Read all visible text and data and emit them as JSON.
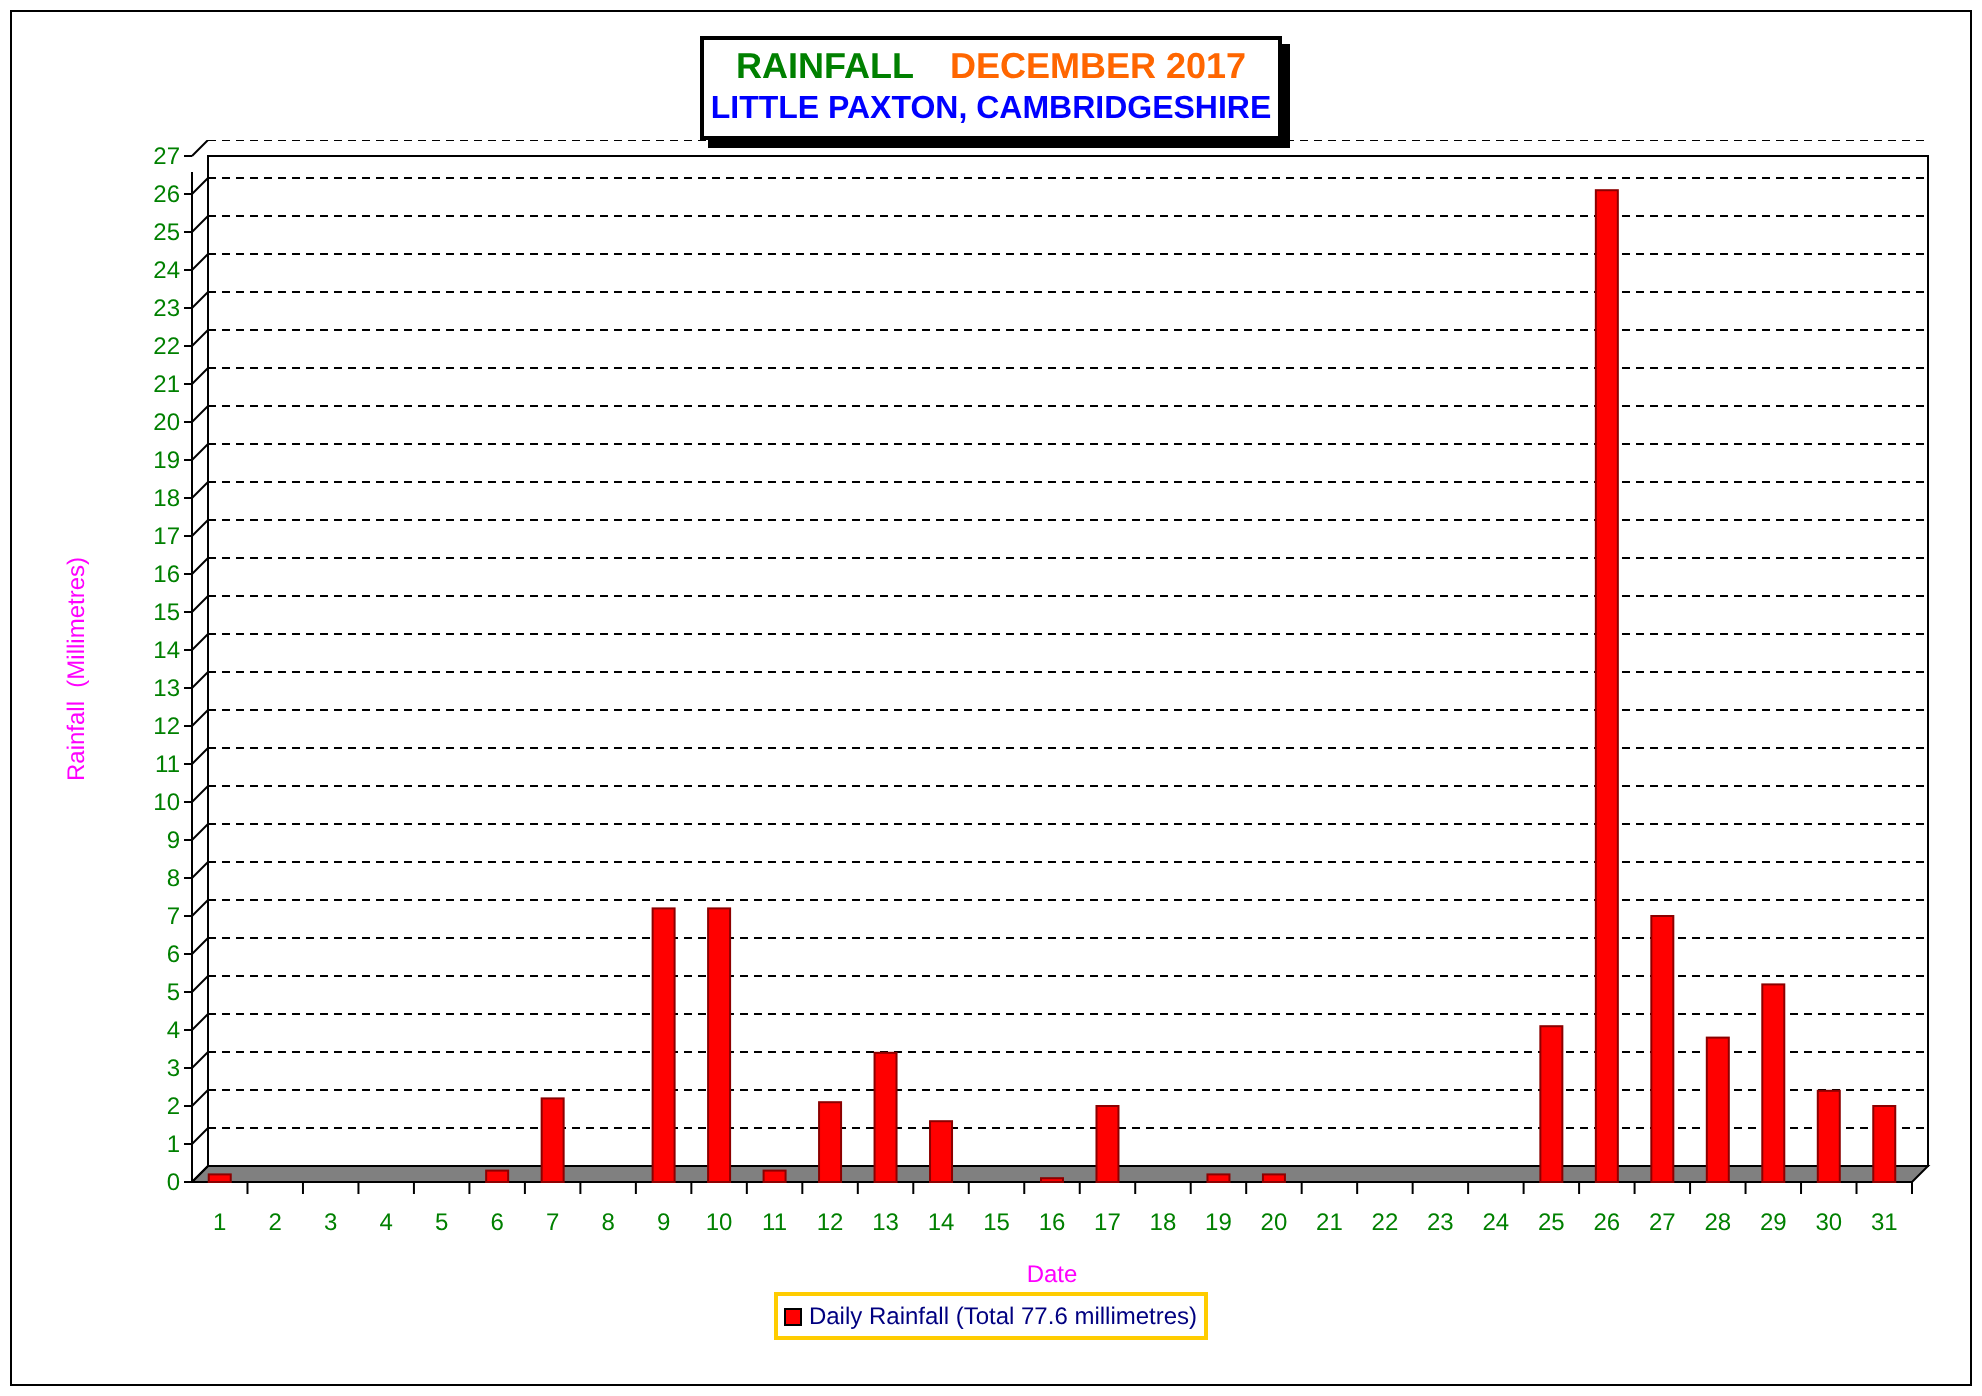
{
  "title": {
    "heading": "RAINFALL",
    "period": "DECEMBER 2017",
    "subtitle": "LITTLE PAXTON, CAMBRIDGESHIRE"
  },
  "chart_data": {
    "type": "bar",
    "xlabel": "Date",
    "ylabel": "Rainfall  (Millimetres)",
    "categories": [
      "1",
      "2",
      "3",
      "4",
      "5",
      "6",
      "7",
      "8",
      "9",
      "10",
      "11",
      "12",
      "13",
      "14",
      "15",
      "16",
      "17",
      "18",
      "19",
      "20",
      "21",
      "22",
      "23",
      "24",
      "25",
      "26",
      "27",
      "28",
      "29",
      "30",
      "31"
    ],
    "series": [
      {
        "name": "Daily Rainfall (Total 77.6 millimetres)",
        "color": "#ff0000",
        "values": [
          0.2,
          0,
          0,
          0,
          0,
          0.3,
          2.2,
          0,
          7.2,
          7.2,
          0.3,
          2.1,
          3.4,
          1.6,
          0,
          0.1,
          2.0,
          0,
          0.2,
          0.2,
          0,
          0,
          0,
          0,
          4.1,
          26.1,
          7.0,
          3.8,
          5.2,
          2.4,
          2.0
        ]
      }
    ],
    "ylim": [
      0,
      27
    ],
    "yticks": [
      0,
      1,
      2,
      3,
      4,
      5,
      6,
      7,
      8,
      9,
      10,
      11,
      12,
      13,
      14,
      15,
      16,
      17,
      18,
      19,
      20,
      21,
      22,
      23,
      24,
      25,
      26,
      27
    ]
  }
}
